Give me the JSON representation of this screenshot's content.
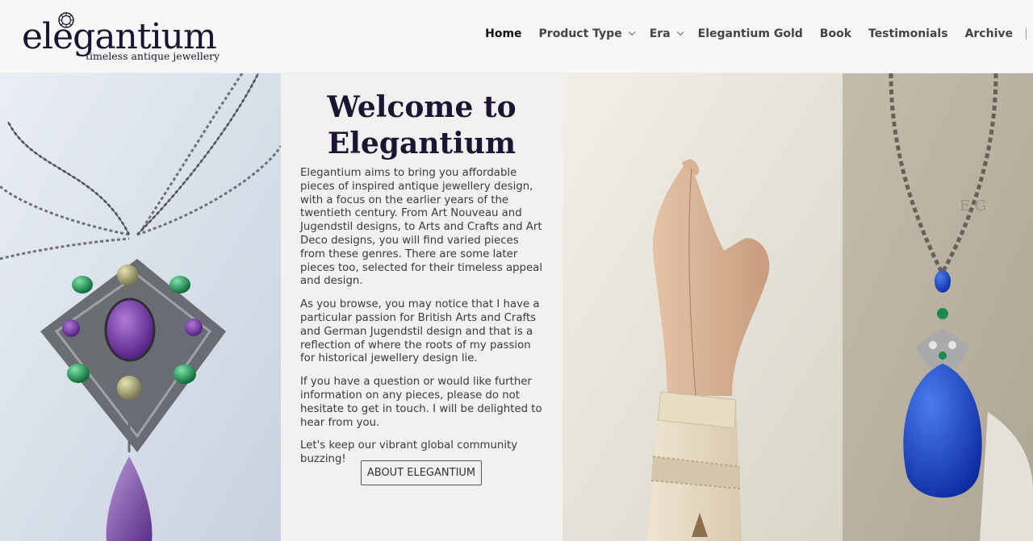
{
  "brand": {
    "name": "elegantium",
    "tagline": "timeless antique jewellery"
  },
  "nav": {
    "items": [
      {
        "label": "Home",
        "active": true,
        "dropdown": false
      },
      {
        "label": "Product Type",
        "active": false,
        "dropdown": true
      },
      {
        "label": "Era",
        "active": false,
        "dropdown": true
      },
      {
        "label": "Elegantium Gold",
        "active": false,
        "dropdown": false
      },
      {
        "label": "Book",
        "active": false,
        "dropdown": false
      },
      {
        "label": "Testimonials",
        "active": false,
        "dropdown": false
      },
      {
        "label": "Archive",
        "active": false,
        "dropdown": false
      }
    ]
  },
  "intro": {
    "title_line1": "Welcome to",
    "title_line2": "Elegantium",
    "paragraphs": [
      "Elegantium aims to bring you affordable pieces of inspired antique jewellery design, with a focus on the earlier years of the twentieth century. From Art Nouveau and Jugendstil designs, to Arts and Crafts and Art Deco designs, you will find varied pieces from these genres. There are some later pieces too, selected for their timeless appeal and design.",
      "As you browse, you may notice that I have a particular passion for British Arts and Crafts and German Jugendstil design and that is a reflection of where the roots of my passion for historical jewellery design lie.",
      "If you have a question or would like further information on any pieces, please do not hesitate to get in touch. I will be delighted to hear from you.",
      "Let's keep our vibrant global community buzzing!"
    ],
    "button_label": "ABOUT ELEGANTIUM"
  },
  "colors": {
    "brand_dark": "#1b1330",
    "header_bg": "#f7f7f7",
    "intro_bg": "#f1f1f1"
  }
}
